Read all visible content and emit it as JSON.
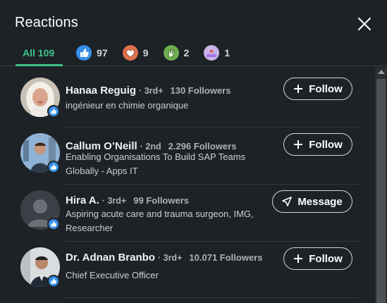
{
  "dialog": {
    "title": "Reactions"
  },
  "tabs": [
    {
      "label": "All 109",
      "icon": "all"
    },
    {
      "label": "97",
      "icon": "like-reaction-icon"
    },
    {
      "label": "9",
      "icon": "love-reaction-icon"
    },
    {
      "label": "2",
      "icon": "celebrate-reaction-icon"
    },
    {
      "label": "1",
      "icon": "support-reaction-icon"
    }
  ],
  "people": [
    {
      "name": "Hanaa Reguig",
      "degree": "· 3rd+",
      "followers": "130 Followers",
      "headline": "ingénieur en chimie organique",
      "action": "Follow",
      "reaction": "like"
    },
    {
      "name": "Callum O’Neill",
      "degree": "· 2nd",
      "followers": "2.296 Followers",
      "headline": "Enabling Organisations To Build SAP Teams Globally - Apps IT",
      "action": "Follow",
      "reaction": "like"
    },
    {
      "name": "Hira A.",
      "degree": "· 3rd+",
      "followers": "99 Followers",
      "headline": "Aspiring acute care and trauma surgeon, IMG, Researcher",
      "action": "Message",
      "reaction": "like"
    },
    {
      "name": "Dr. Adnan Branbo",
      "degree": "· 3rd+",
      "followers": "10.071 Followers",
      "headline": "Chief Executive Officer",
      "action": "Follow",
      "reaction": "like"
    }
  ],
  "colors": {
    "accent": "#3cc58a",
    "like": "#378fe9",
    "love": "#df704d",
    "celebrate": "#6dae4f",
    "support": "#a872e8"
  }
}
